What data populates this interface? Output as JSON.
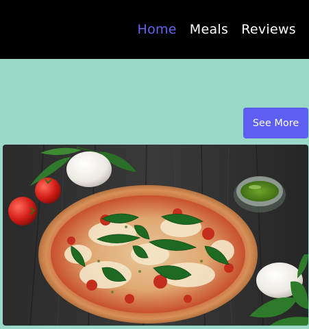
{
  "nav": {
    "items": [
      {
        "label": "Home",
        "active": true
      },
      {
        "label": "Meals",
        "active": false
      },
      {
        "label": "Reviews",
        "active": false
      }
    ]
  },
  "hero": {
    "button_label": "See More"
  },
  "colors": {
    "navbar_bg": "#000000",
    "page_bg": "#9ad9c7",
    "accent": "#5c5ff2",
    "active_link": "#6466f0"
  }
}
